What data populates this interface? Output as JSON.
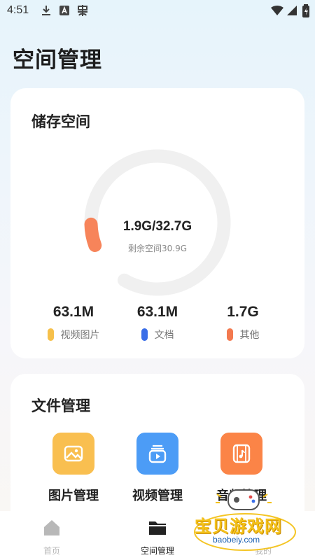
{
  "status_bar": {
    "time": "4:51",
    "left_icons": [
      "download-icon",
      "a-box-icon",
      "bug-icon"
    ],
    "right_icons": [
      "wifi-icon",
      "signal-icon",
      "battery-icon"
    ]
  },
  "page_title": "空间管理",
  "storage": {
    "title": "储存空间",
    "usage": "1.9G/32.7G",
    "remaining": "剩余空间30.9G",
    "used_fraction": 0.058,
    "gauge_color": "#f7845a",
    "stats": [
      {
        "value": "63.1M",
        "label": "视频图片",
        "color": "#f6c04b"
      },
      {
        "value": "63.1M",
        "label": "文档",
        "color": "#3a6ee8"
      },
      {
        "value": "1.7G",
        "label": "其他",
        "color": "#f3794f"
      }
    ]
  },
  "files": {
    "title": "文件管理",
    "items": [
      {
        "label": "图片管理",
        "icon": "image-folder-icon",
        "color": "#f9bf50"
      },
      {
        "label": "视频管理",
        "icon": "video-folder-icon",
        "color": "#4c9cf6"
      },
      {
        "label": "音频管理",
        "icon": "audio-folder-icon",
        "color": "#fb8447"
      }
    ]
  },
  "nav": {
    "items": [
      {
        "label": "首页",
        "icon": "home-icon",
        "active": false
      },
      {
        "label": "空间管理",
        "icon": "folder-icon",
        "active": true
      },
      {
        "label": "我的",
        "icon": "profile-icon",
        "active": false
      }
    ],
    "active_color": "#222222",
    "inactive_color": "#b8b8b8"
  },
  "watermark": {
    "text": "宝贝游戏网",
    "url": "baobeiy.com"
  }
}
